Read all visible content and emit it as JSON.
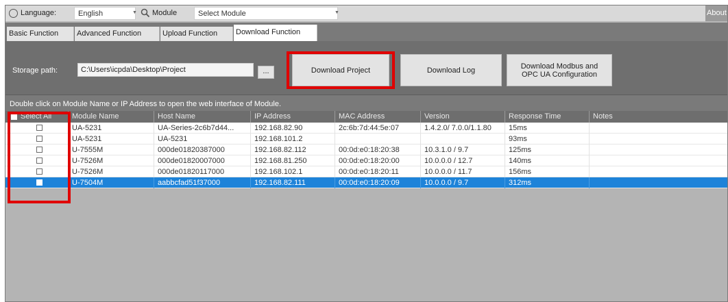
{
  "topbar": {
    "language_label": "Language:",
    "language_value": "English",
    "module_label": "Module",
    "module_value": "Select Module",
    "about_label": "About"
  },
  "tabs": [
    {
      "label": "Basic Function"
    },
    {
      "label": "Advanced Function"
    },
    {
      "label": "Upload Function"
    },
    {
      "label": "Download Function"
    }
  ],
  "panel": {
    "storage_label": "Storage path:",
    "storage_value": "C:\\Users\\icpda\\Desktop\\Project",
    "browse_label": "...",
    "download_project": "Download Project",
    "download_log": "Download Log",
    "download_modbus_line1": "Download Modbus and",
    "download_modbus_line2": "OPC UA Configuration"
  },
  "hint": "Double click on Module Name or IP Address to open the web interface of Module.",
  "table": {
    "headers": [
      "Select All",
      "Module Name",
      "Host Name",
      "IP Address",
      "MAC Address",
      "Version",
      "Response Time",
      "Notes"
    ],
    "rows": [
      {
        "module": "UA-5231",
        "host": "UA-Series-2c6b7d44...",
        "ip": "192.168.82.90",
        "mac": "2c:6b:7d:44:5e:07",
        "version": "1.4.2.0/ 7.0.0/1.1.80",
        "response": "15ms",
        "notes": ""
      },
      {
        "module": "UA-5231",
        "host": "UA-5231",
        "ip": "192.168.101.2",
        "mac": "",
        "version": "",
        "response": "93ms",
        "notes": ""
      },
      {
        "module": "U-7555M",
        "host": "000de01820387000",
        "ip": "192.168.82.112",
        "mac": "00:0d:e0:18:20:38",
        "version": "10.3.1.0 / 9.7",
        "response": "125ms",
        "notes": ""
      },
      {
        "module": "U-7526M",
        "host": "000de01820007000",
        "ip": "192.168.81.250",
        "mac": "00:0d:e0:18:20:00",
        "version": "10.0.0.0 / 12.7",
        "response": "140ms",
        "notes": ""
      },
      {
        "module": "U-7526M",
        "host": "000de01820117000",
        "ip": "192.168.102.1",
        "mac": "00:0d:e0:18:20:11",
        "version": "10.0.0.0 / 11.7",
        "response": "156ms",
        "notes": ""
      },
      {
        "module": "U-7504M",
        "host": "aabbcfad51f37000",
        "ip": "192.168.82.111",
        "mac": "00:0d:e0:18:20:09",
        "version": "10.0.0.0 / 9.7",
        "response": "312ms",
        "notes": ""
      }
    ],
    "selected_row": 5
  },
  "colors": {
    "highlight_box": "#e00000",
    "selected_row": "#1e83d9",
    "panel_bg": "#6f6f6f"
  }
}
